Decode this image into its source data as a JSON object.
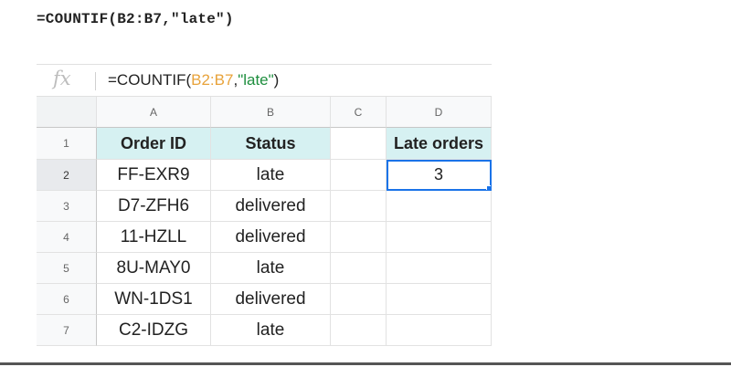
{
  "caption": "=COUNTIF(B2:B7,\"late\")",
  "formula_bar": {
    "fx_label": "fx",
    "formula_prefix": "=COUNTIF(",
    "formula_range": "B2:B7",
    "formula_sep": ",",
    "formula_criterion": "\"late\"",
    "formula_suffix": ")"
  },
  "column_headers": [
    "A",
    "B",
    "C",
    "D"
  ],
  "rows": [
    {
      "num": "1",
      "a": "Order ID",
      "b": "Status",
      "c": "",
      "d": "Late orders"
    },
    {
      "num": "2",
      "a": "FF-EXR9",
      "b": "late",
      "c": "",
      "d": "3"
    },
    {
      "num": "3",
      "a": "D7-ZFH6",
      "b": "delivered",
      "c": "",
      "d": ""
    },
    {
      "num": "4",
      "a": "11-HZLL",
      "b": "delivered",
      "c": "",
      "d": ""
    },
    {
      "num": "5",
      "a": "8U-MAY0",
      "b": "late",
      "c": "",
      "d": ""
    },
    {
      "num": "6",
      "a": "WN-1DS1",
      "b": "delivered",
      "c": "",
      "d": ""
    },
    {
      "num": "7",
      "a": "C2-IDZG",
      "b": "late",
      "c": "",
      "d": ""
    }
  ],
  "selected_cell": "D2",
  "colors": {
    "header_fill": "#d6f1f2",
    "selection": "#1a73e8",
    "range_ref": "#e8a33b",
    "string_literal": "#1e8e3e"
  }
}
